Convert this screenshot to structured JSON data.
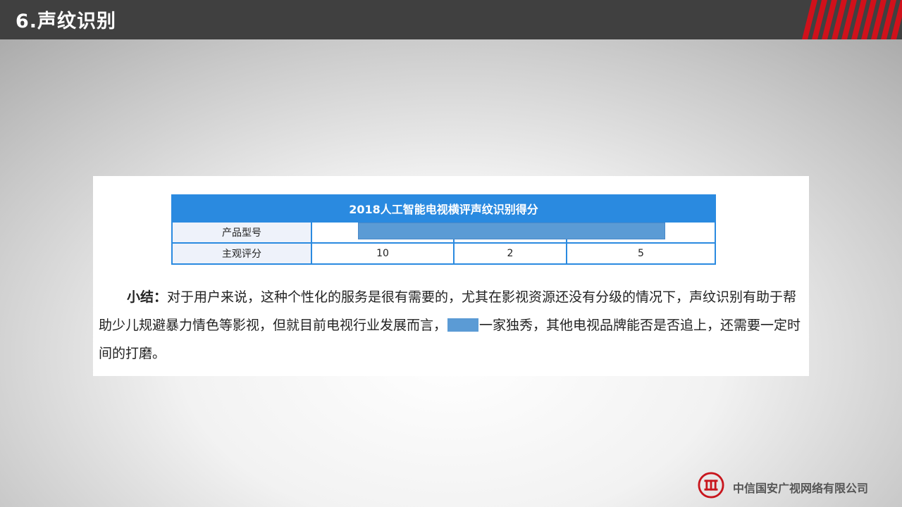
{
  "header": {
    "title": "6.声纹识别"
  },
  "table": {
    "title": "2018人工智能电视横评声纹识别得分",
    "rows": [
      {
        "label": "产品型号",
        "cells": [
          "",
          "",
          ""
        ]
      },
      {
        "label": "主观评分",
        "cells": [
          "10",
          "2",
          "5"
        ]
      }
    ]
  },
  "summary": {
    "label": "小结：",
    "text_part1": "对于用户来说，这种个性化的服务是很有需要的，尤其在影视资源还没有分级的情况下，声纹识别有助于帮助少儿规避暴力情色等影视，但就目前电视行业发展而言，",
    "text_part2": "一家独秀，其他电视品牌能否是否追上，还需要一定时间的打磨。"
  },
  "footer": {
    "company": "中信国安广视网络有限公司"
  },
  "colors": {
    "header_bg": "#404040",
    "accent_red": "#d0111b",
    "table_blue": "#2a8ae0",
    "redaction_blue": "#5b9bd5"
  },
  "icons": {
    "logo": "citic-logo-icon"
  }
}
